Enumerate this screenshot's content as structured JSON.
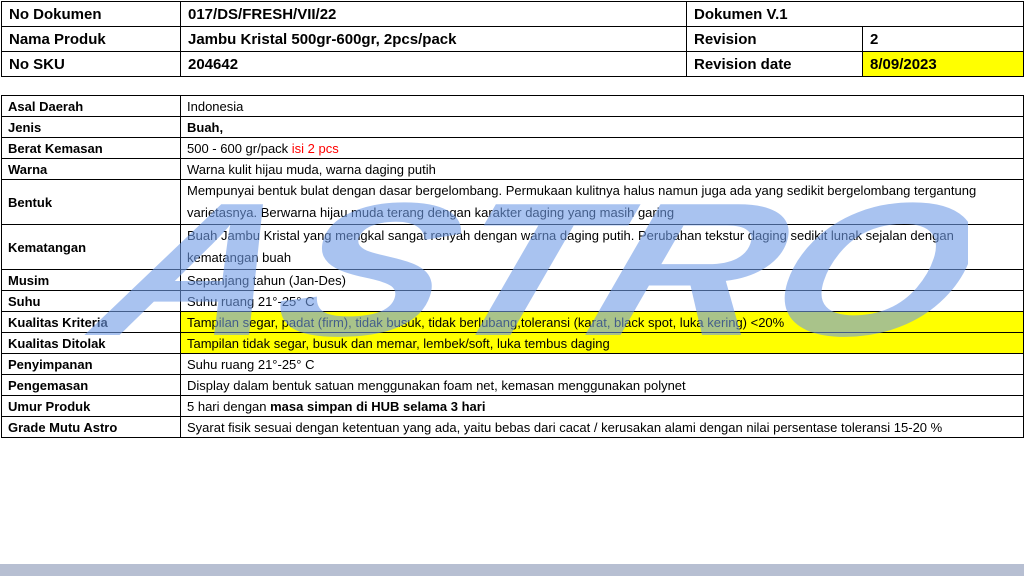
{
  "header": {
    "row1": {
      "label": "No Dokumen",
      "value": "017/DS/FRESH/VII/22",
      "meta_label": "Dokumen V.1",
      "meta_value": ""
    },
    "row2": {
      "label": "Nama Produk",
      "value": "Jambu Kristal 500gr-600gr, 2pcs/pack",
      "meta_label": "Revision",
      "meta_value": "2"
    },
    "row3": {
      "label": "No SKU",
      "value": "204642",
      "meta_label": "Revision date",
      "meta_value": "8/09/2023"
    }
  },
  "spec": {
    "asal": {
      "label": "Asal Daerah",
      "value": "Indonesia"
    },
    "jenis": {
      "label": "Jenis",
      "value": "Buah,"
    },
    "berat": {
      "label": "Berat Kemasan",
      "value": "500 - 600 gr/pack ",
      "value_red": "isi 2 pcs"
    },
    "warna": {
      "label": "Warna",
      "value": "Warna kulit hijau muda, warna daging putih"
    },
    "bentuk": {
      "label": "Bentuk",
      "value": "Mempunyai bentuk bulat  dengan dasar bergelombang. Permukaan kulitnya halus namun juga ada yang sedikit bergelombang tergantung varietasnya. Berwarna hijau muda terang dengan karakter daging yang masih garing"
    },
    "kematangan": {
      "label": "Kematangan",
      "value": "Buah Jambu Kristal yang mengkal sangat renyah dengan warna daging putih. Perubahan tekstur daging sedikit lunak sejalan dengan kematangan buah"
    },
    "musim": {
      "label": "Musim",
      "value": "Sepanjang tahun (Jan-Des)"
    },
    "suhu": {
      "label": "Suhu",
      "value": "Suhu ruang 21°-25° C"
    },
    "kriteria": {
      "label": "Kualitas Kriteria",
      "value": "Tampilan segar, padat (firm), tidak busuk, tidak berlubang,toleransi (karat, black spot, luka kering) <20%"
    },
    "ditolak": {
      "label": "Kualitas Ditolak",
      "value": "Tampilan tidak segar, busuk dan memar, lembek/soft, luka tembus daging"
    },
    "penyimpanan": {
      "label": "Penyimpanan",
      "value": "Suhu ruang 21°-25° C"
    },
    "pengemasan": {
      "label": "Pengemasan",
      "value": "Display dalam bentuk satuan menggunakan foam net, kemasan menggunakan polynet"
    },
    "umur": {
      "label": "Umur Produk",
      "value": "5 hari dengan ",
      "value_bold": "masa simpan di HUB selama 3 hari"
    },
    "grade": {
      "label": "Grade Mutu Astro",
      "value": "Syarat fisik sesuai dengan ketentuan yang ada, yaitu bebas dari cacat / kerusakan alami dengan  nilai persentase toleransi 15-20 %"
    }
  },
  "watermark": {
    "text": "ASTRO",
    "color": "#6f9be6"
  },
  "colors": {
    "highlight": "#ffff00",
    "accent_red": "#ff0000",
    "bar": "#b7bfd2"
  }
}
